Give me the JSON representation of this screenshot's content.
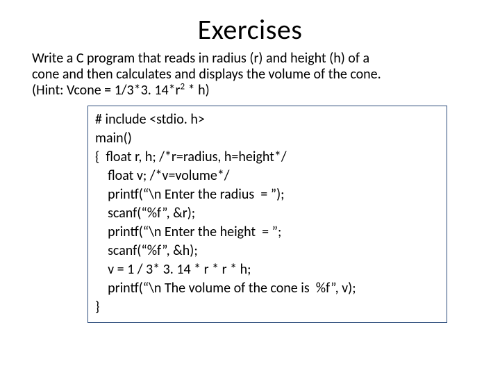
{
  "title": "Exercises",
  "prompt": {
    "line1": "Write a C program that reads in radius (r) and height (h) of a",
    "line2": "cone and then calculates and displays the volume of the cone.",
    "line3_before": "(Hint: Vcone = 1/3*3. 14*r",
    "line3_sup": "2",
    "line3_after": " * h)"
  },
  "code": {
    "l1": "# include <stdio. h>",
    "l2": "main()",
    "l3": "{  float r, h; /*r=radius, h=height*/",
    "l4": "    float v; /*v=volume*/",
    "l5": "    printf(“\\n Enter the radius  = ”);",
    "l6": "    scanf(“%f”, &r);",
    "l7": "    printf(“\\n Enter the height  = ”;",
    "l8": "    scanf(“%f”, &h);",
    "l9": "    v = 1 / 3* 3. 14 * r * r * h;",
    "l10": "    printf(“\\n The volume of the cone is  %f”, v);",
    "l11": "}"
  }
}
